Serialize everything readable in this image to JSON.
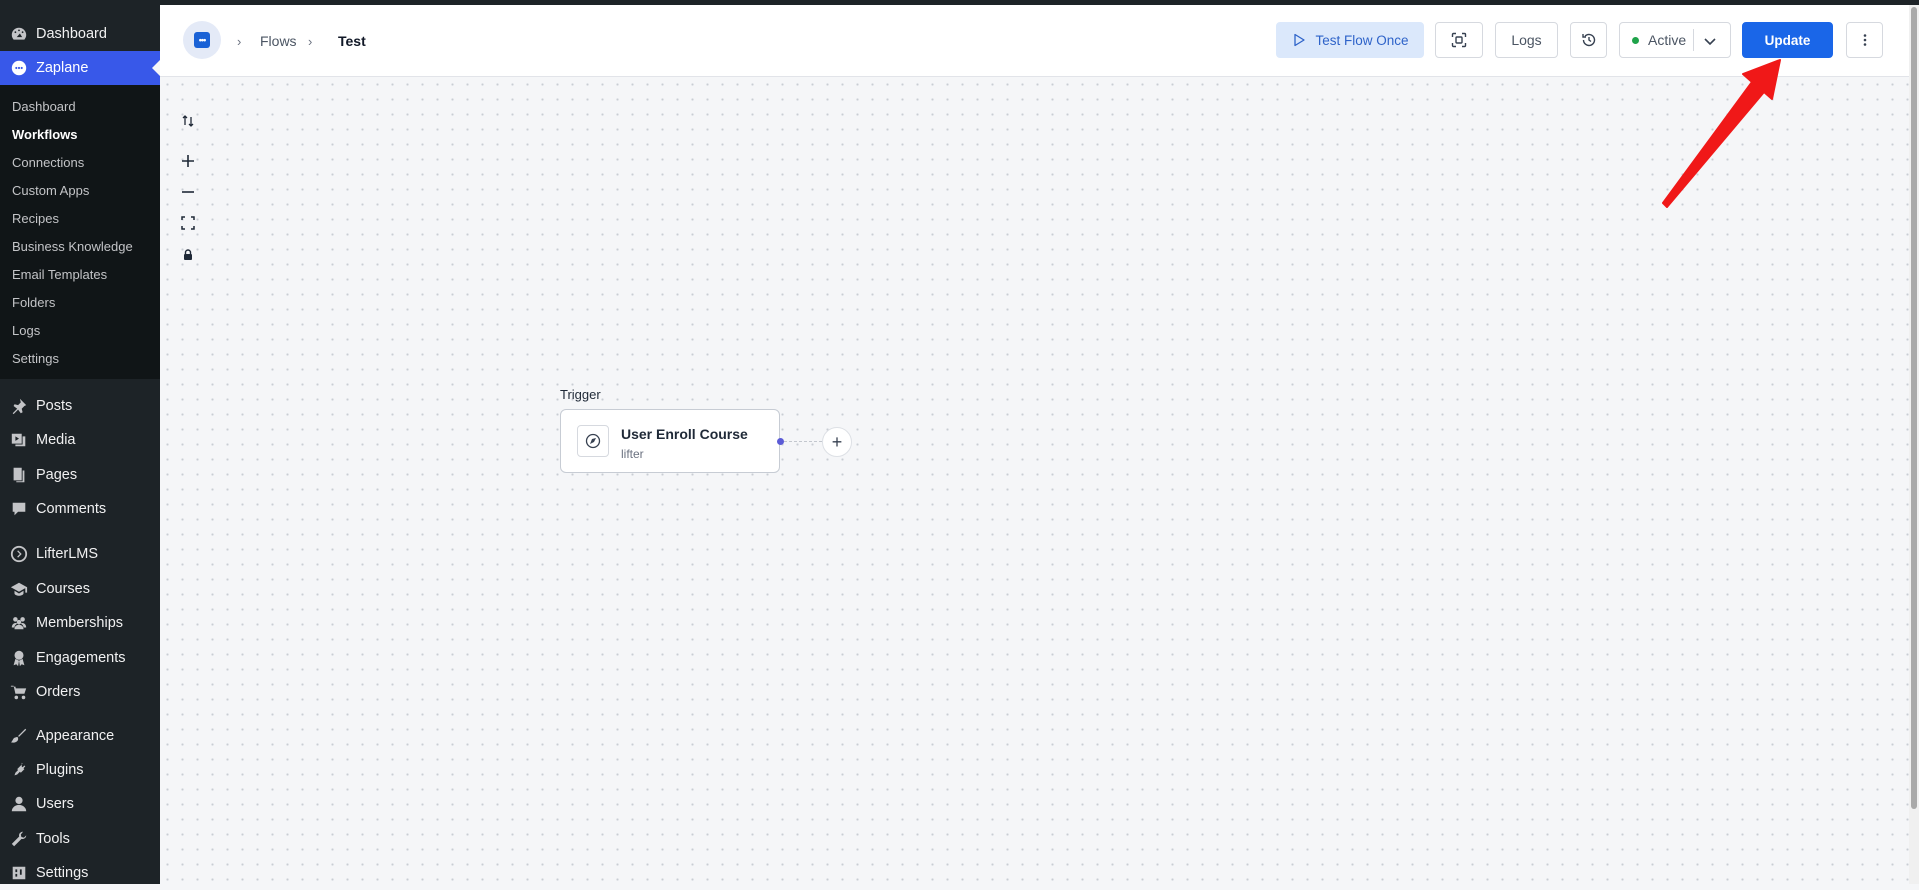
{
  "sidebar": {
    "top_items": [
      {
        "label": "Dashboard",
        "icon": "dashboard-icon"
      },
      {
        "label": "Zaplane",
        "icon": "zaplane-icon"
      }
    ],
    "submenu": [
      "Dashboard",
      "Workflows",
      "Connections",
      "Custom Apps",
      "Recipes",
      "Business Knowledge",
      "Email Templates",
      "Folders",
      "Logs",
      "Settings"
    ],
    "submenu_current": "Workflows",
    "items": [
      {
        "label": "Posts",
        "icon": "pin-icon"
      },
      {
        "label": "Media",
        "icon": "media-icon"
      },
      {
        "label": "Pages",
        "icon": "pages-icon"
      },
      {
        "label": "Comments",
        "icon": "comment-icon"
      },
      {
        "label": "LifterLMS",
        "icon": "lifterlms-icon"
      },
      {
        "label": "Courses",
        "icon": "graduation-cap-icon"
      },
      {
        "label": "Memberships",
        "icon": "groups-icon"
      },
      {
        "label": "Engagements",
        "icon": "award-icon"
      },
      {
        "label": "Orders",
        "icon": "cart-icon"
      },
      {
        "label": "Appearance",
        "icon": "brush-icon"
      },
      {
        "label": "Plugins",
        "icon": "plug-icon"
      },
      {
        "label": "Users",
        "icon": "user-icon"
      },
      {
        "label": "Tools",
        "icon": "wrench-icon"
      },
      {
        "label": "Settings",
        "icon": "settings-icon"
      }
    ]
  },
  "header": {
    "logo_text": "•••",
    "breadcrumbs": [
      "Flows",
      "Test"
    ],
    "test_flow_label": "Test Flow Once",
    "logs_label": "Logs",
    "status_label": "Active",
    "status_color": "#1fa34a",
    "update_label": "Update",
    "accent": "#1a66e8"
  },
  "canvas": {
    "trigger_label": "Trigger",
    "node": {
      "title": "User Enroll Course",
      "app": "lifter"
    },
    "add_symbol": "+"
  },
  "annotation": {
    "arrow_color": "#f01818"
  }
}
